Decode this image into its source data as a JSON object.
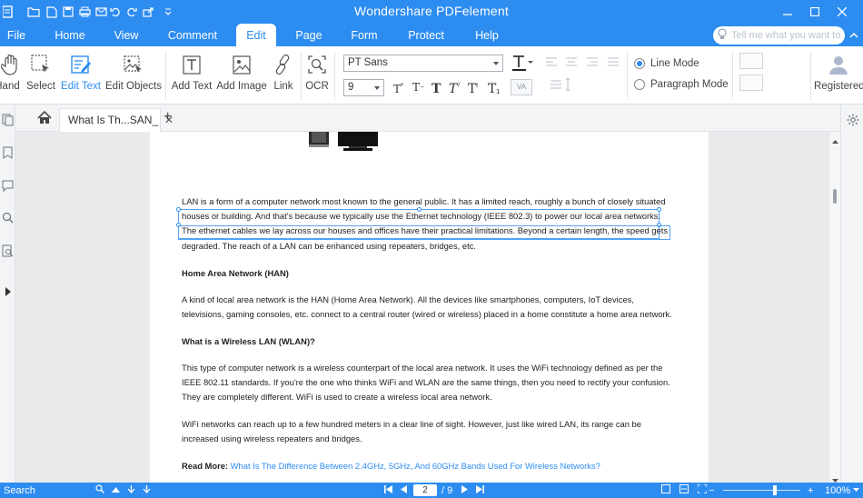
{
  "app": {
    "title": "Wondershare PDFelement"
  },
  "menu": {
    "tabs": [
      {
        "label": "File"
      },
      {
        "label": "Home"
      },
      {
        "label": "View"
      },
      {
        "label": "Comment"
      },
      {
        "label": "Edit"
      },
      {
        "label": "Page"
      },
      {
        "label": "Form"
      },
      {
        "label": "Protect"
      },
      {
        "label": "Help"
      }
    ],
    "active_tab": "Edit",
    "tell_me_placeholder": "Tell me what you want to"
  },
  "ribbon": {
    "tools": [
      {
        "label": "Hand",
        "icon": "hand-icon"
      },
      {
        "label": "Select",
        "icon": "select-icon"
      },
      {
        "label": "Edit Text",
        "icon": "edit-text-icon"
      },
      {
        "label": "Edit Objects",
        "icon": "edit-objects-icon"
      },
      {
        "label": "Add Text",
        "icon": "add-text-icon"
      },
      {
        "label": "Add Image",
        "icon": "add-image-icon"
      },
      {
        "label": "Link",
        "icon": "link-icon"
      },
      {
        "label": "OCR",
        "icon": "ocr-icon"
      }
    ],
    "active_tool": "Edit Text",
    "font_name": "PT Sans",
    "font_size": "9",
    "line_mode_label": "Line Mode",
    "paragraph_mode_label": "Paragraph Mode",
    "line_mode_selected": true,
    "account_label": "Registered"
  },
  "tabs": {
    "document_tab": "What Is Th...SAN_"
  },
  "document": {
    "paragraphs": [
      {
        "type": "text",
        "text": "LAN is a form of a computer network most known to the general public. It has a limited reach, roughly a bunch of closely situated houses or building. And that's because we typically use the Ethernet technology (IEEE 802.3) to power our local area networks. The ethernet cables we lay across our houses and offices have their practical limitations. Beyond a certain length, the speed gets degraded. The reach of a LAN can be enhanced using repeaters, bridges, etc."
      },
      {
        "type": "heading",
        "text": "Home Area Network (HAN)"
      },
      {
        "type": "text",
        "text": "A kind of local area network is the HAN (Home Area Network). All the devices like smartphones, computers, IoT devices, televisions, gaming consoles, etc. connect to a central router (wired or wireless) placed in a home constitute a home area network."
      },
      {
        "type": "heading",
        "text": "What is a Wireless LAN (WLAN)?"
      },
      {
        "type": "text",
        "text": "This type of computer network is a wireless counterpart of the local area network. It uses the WiFi technology defined as per the IEEE 802.11 standards. If you're the one who thinks WiFi and WLAN are the same things, then you need to rectify your confusion. They are completely different. WiFi is used to create a wireless local area network."
      },
      {
        "type": "text",
        "text": "WiFi networks can reach up to a few hundred meters in a clear line of sight. However, just like wired LAN, its range can be increased using wireless repeaters and bridges."
      }
    ],
    "read_more_label": "Read More:",
    "read_more_link": "What Is The Difference Between 2.4GHz, 5GHz, And 60GHz Bands Used For Wireless Networks?"
  },
  "statusbar": {
    "search_label": "Search",
    "current_page": "2",
    "total_pages": "/ 9",
    "zoom": "100%"
  },
  "colors": {
    "accent": "#2d8cf0",
    "link": "#2d8cf0"
  }
}
